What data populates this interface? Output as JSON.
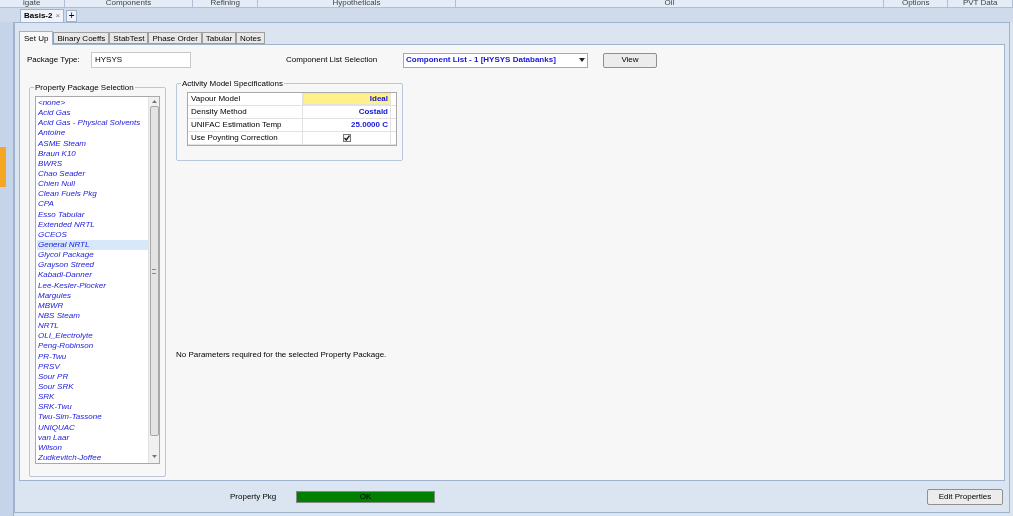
{
  "ribbon_groups": [
    "igate",
    "Components",
    "Refining",
    "Hypotheticals",
    "Oil",
    "Options",
    "PVT Data"
  ],
  "document_tabs": [
    {
      "label": "Basis-2",
      "selected": true,
      "close": "×"
    }
  ],
  "add_tab": "+",
  "tabs": [
    {
      "label": "Set Up",
      "selected": true
    },
    {
      "label": "Binary Coeffs",
      "selected": false
    },
    {
      "label": "StabTest",
      "selected": false
    },
    {
      "label": "Phase Order",
      "selected": false
    },
    {
      "label": "Tabular",
      "selected": false
    },
    {
      "label": "Notes",
      "selected": false
    }
  ],
  "package_type": {
    "label": "Package Type:",
    "value": "HYSYS"
  },
  "component_list": {
    "label": "Component List Selection",
    "value": "Component List - 1 [HYSYS Databanks]"
  },
  "view_button": "View",
  "property_package_selection": {
    "title": "Property Package Selection",
    "items": [
      {
        "label": "<none>",
        "selected": false
      },
      {
        "label": "Acid Gas",
        "selected": false
      },
      {
        "label": "Acid Gas - Physical Solvents",
        "selected": false
      },
      {
        "label": "Antoine",
        "selected": false
      },
      {
        "label": "ASME Steam",
        "selected": false
      },
      {
        "label": "Braun K10",
        "selected": false
      },
      {
        "label": "BWRS",
        "selected": false
      },
      {
        "label": "Chao Seader",
        "selected": false
      },
      {
        "label": "Chien Null",
        "selected": false
      },
      {
        "label": "Clean Fuels Pkg",
        "selected": false
      },
      {
        "label": "CPA",
        "selected": false
      },
      {
        "label": "Esso Tabular",
        "selected": false
      },
      {
        "label": "Extended NRTL",
        "selected": false
      },
      {
        "label": "GCEOS",
        "selected": false
      },
      {
        "label": "General NRTL",
        "selected": true
      },
      {
        "label": "Glycol Package",
        "selected": false
      },
      {
        "label": "Grayson Streed",
        "selected": false
      },
      {
        "label": "Kabadi-Danner",
        "selected": false
      },
      {
        "label": "Lee-Kesler-Plocker",
        "selected": false
      },
      {
        "label": "Margules",
        "selected": false
      },
      {
        "label": "MBWR",
        "selected": false
      },
      {
        "label": "NBS Steam",
        "selected": false
      },
      {
        "label": "NRTL",
        "selected": false
      },
      {
        "label": "OLI_Electrolyte",
        "selected": false
      },
      {
        "label": "Peng-Robinson",
        "selected": false
      },
      {
        "label": "PR-Twu",
        "selected": false
      },
      {
        "label": "PRSV",
        "selected": false
      },
      {
        "label": "Sour PR",
        "selected": false
      },
      {
        "label": "Sour SRK",
        "selected": false
      },
      {
        "label": "SRK",
        "selected": false
      },
      {
        "label": "SRK-Twu",
        "selected": false
      },
      {
        "label": "Twu-Sim-Tassone",
        "selected": false
      },
      {
        "label": "UNIQUAC",
        "selected": false
      },
      {
        "label": "van Laar",
        "selected": false
      },
      {
        "label": "Wilson",
        "selected": false
      },
      {
        "label": "Zudkevitch-Joffee",
        "selected": false
      }
    ]
  },
  "activity_model": {
    "title": "Activity Model Specifications",
    "rows": [
      {
        "label": "Vapour Model",
        "kind": "text",
        "value": "Ideal",
        "selected": true
      },
      {
        "label": "Density Method",
        "kind": "text",
        "value": "Costald",
        "selected": false
      },
      {
        "label": "UNIFAC Estimation Temp",
        "kind": "text",
        "value": "25.0000 C",
        "selected": false
      },
      {
        "label": "Use Poynting Correction",
        "kind": "checkbox",
        "checked": true,
        "selected": false
      }
    ]
  },
  "message": "No Parameters required for the selected Property Package.",
  "status": {
    "label": "Property Pkg",
    "value": "OK",
    "ok": true
  },
  "edit_button": "Edit Properties"
}
